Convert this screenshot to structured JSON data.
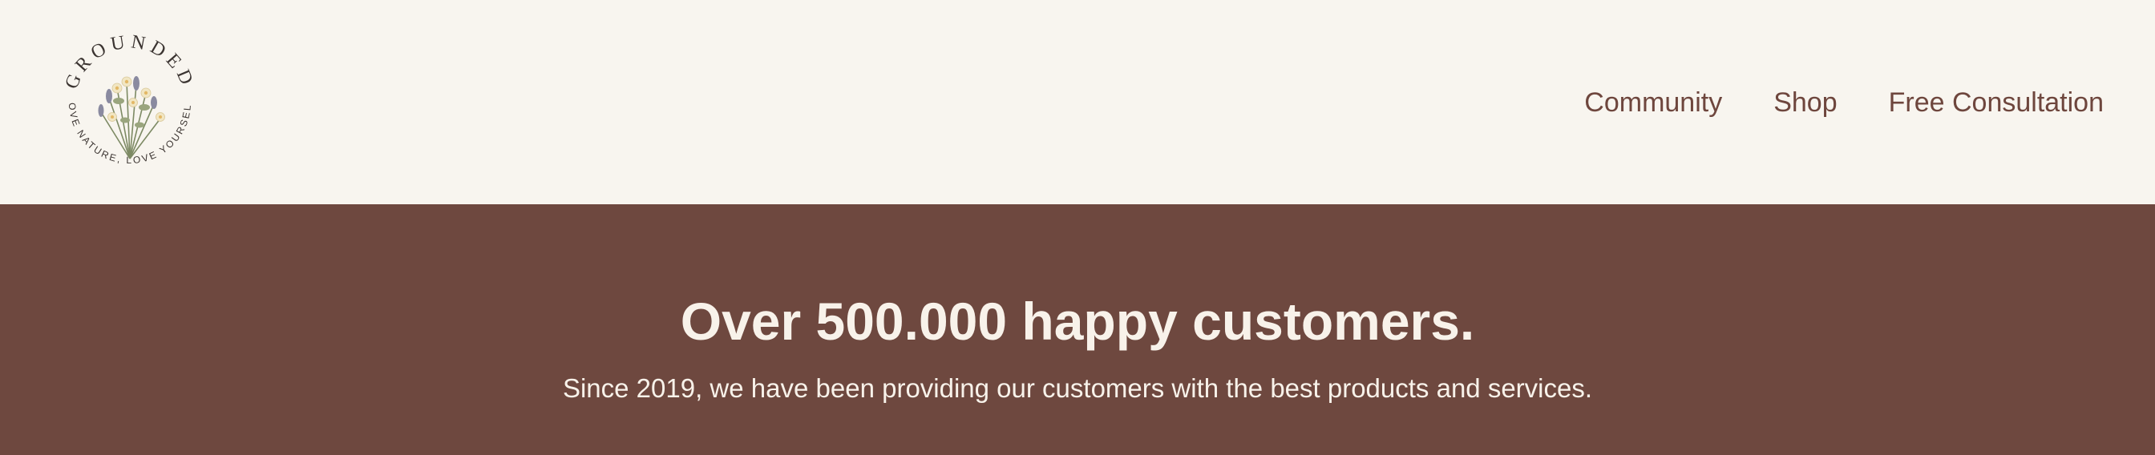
{
  "brand": {
    "logo_top_text": "GROUNDED",
    "logo_bottom_text": "LOVE NATURE, LOVE YOURSELF",
    "logo_icon": "wildflower-bouquet-icon"
  },
  "nav": {
    "items": [
      {
        "label": "Community"
      },
      {
        "label": "Shop"
      },
      {
        "label": "Free Consultation"
      }
    ]
  },
  "hero": {
    "title": "Over 500.000 happy customers.",
    "subtitle": "Since 2019, we have been providing our customers with the best products and services."
  },
  "colors": {
    "header_bg": "#f8f5ef",
    "hero_bg": "#6e483f",
    "nav_text": "#6e463d",
    "hero_text": "#f8f2ea"
  }
}
